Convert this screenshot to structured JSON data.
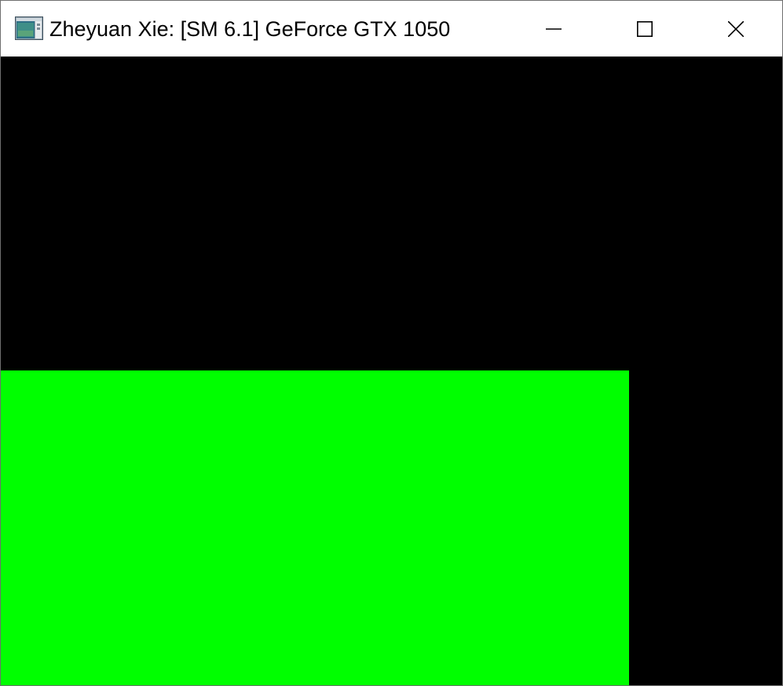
{
  "window": {
    "title": "Zheyuan Xie: [SM 6.1] GeForce GTX 1050",
    "app_icon": "application-window-icon",
    "controls": {
      "minimize_icon": "minimize-icon",
      "maximize_icon": "maximize-icon",
      "close_icon": "close-icon"
    }
  },
  "canvas": {
    "background_color": "#000000",
    "rect_color": "#00ff00"
  }
}
